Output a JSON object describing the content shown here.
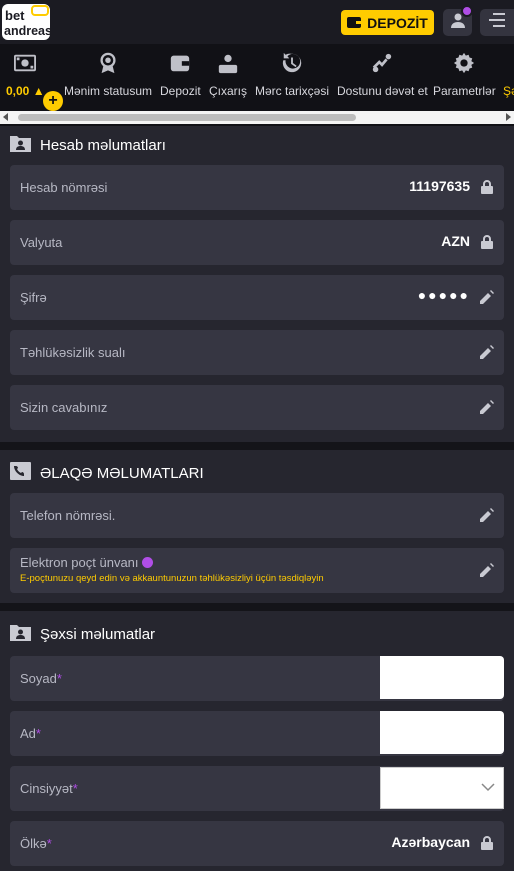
{
  "header": {
    "logo_top": "bet",
    "logo_bottom": "andreas",
    "deposit_label": "DEPOZİT"
  },
  "nav": {
    "balance": "0,00",
    "items": [
      {
        "label": "Mənim statusum",
        "icon": "medal-icon"
      },
      {
        "label": "Depozit",
        "icon": "wallet-icon"
      },
      {
        "label": "Çıxarış",
        "icon": "withdraw-icon"
      },
      {
        "label": "Mərc tarixçəsi",
        "icon": "history-icon"
      },
      {
        "label": "Dostunu dəvət et",
        "icon": "invite-icon"
      },
      {
        "label": "Parametrlər",
        "icon": "gear-icon"
      },
      {
        "label": "Şə",
        "icon": ""
      }
    ]
  },
  "account": {
    "title": "Hesab məlumatları",
    "account_number_label": "Hesab nömrəsi",
    "account_number": "11197635",
    "currency_label": "Valyuta",
    "currency": "AZN",
    "password_label": "Şifrə",
    "password_mask": "●●●●●",
    "security_question_label": "Təhlükəsizlik sualı",
    "answer_label": "Sizin cavabınız"
  },
  "contact": {
    "title": "ƏLAQƏ MƏLUMATLARI",
    "phone_label": "Telefon nömrəsi.",
    "email_label": "Elektron poçt ünvanı",
    "email_hint": "E-poçtunuzu qeyd edin və akkauntunuzun təhlükəsizliyi üçün təsdiqləyin"
  },
  "personal": {
    "title": "Şəxsi məlumatlar",
    "surname_label": "Soyad",
    "name_label": "Ad",
    "gender_label": "Cinsiyyət",
    "country_label": "Ölkə",
    "country": "Azərbaycan",
    "required_mark": "*"
  },
  "colors": {
    "accent": "#ffcc00",
    "purple": "#b04ee6",
    "background": "#1e1e26",
    "row": "#363642"
  }
}
